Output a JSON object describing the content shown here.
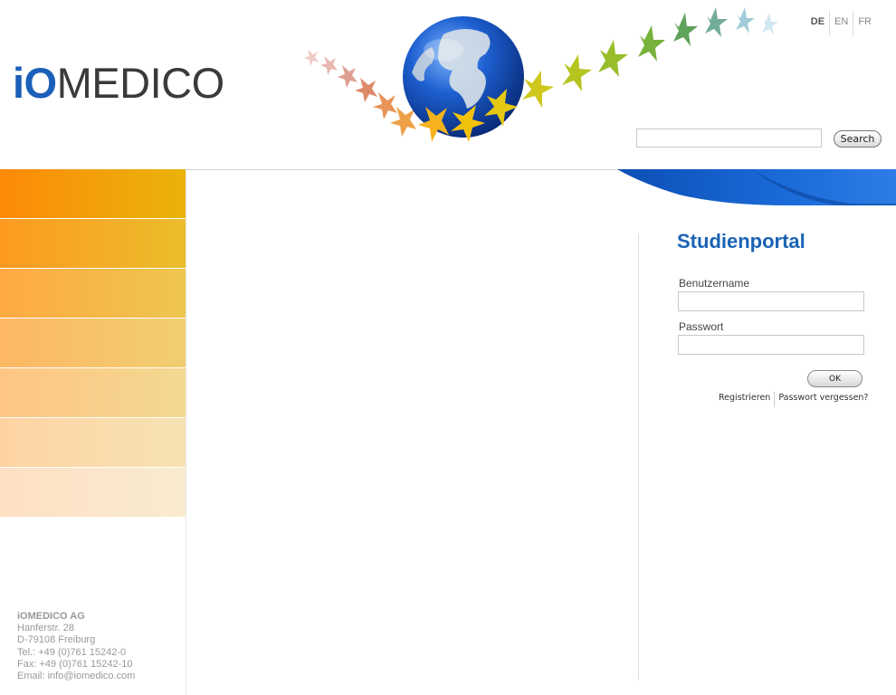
{
  "brand": {
    "logo_io": "iO",
    "logo_medico": "MEDICO"
  },
  "languages": [
    "DE",
    "EN",
    "FR"
  ],
  "search": {
    "value": "",
    "placeholder": "",
    "button_label": "Search"
  },
  "nav": {
    "items": [
      {
        "color_from": "#fd8a08",
        "color_to": "#e9b40a"
      },
      {
        "color_from": "#fd9a20",
        "color_to": "#ebbd2c"
      },
      {
        "color_from": "#fea942",
        "color_to": "#eec64f"
      },
      {
        "color_from": "#feb763",
        "color_to": "#f0cf70"
      },
      {
        "color_from": "#fec583",
        "color_to": "#f3d991"
      },
      {
        "color_from": "#fed3a4",
        "color_to": "#f6e2b3"
      },
      {
        "color_from": "#fee0c3",
        "color_to": "#f9ebcf"
      }
    ]
  },
  "login": {
    "title": "Studienportal",
    "username_label": "Benutzername",
    "username_value": "",
    "password_label": "Passwort",
    "password_value": "",
    "ok_label": "OK",
    "register_label": "Registrieren",
    "forgot_label": "Passwort vergessen?"
  },
  "address": {
    "company": "iOMEDICO AG",
    "street": "Hanferstr. 28",
    "city": "D-79108 Freiburg",
    "tel": "Tel.: +49 (0)761 15242-0",
    "fax": "Fax: +49 (0)761 15242-10",
    "email": "Email: info@iomedico.com"
  },
  "colors": {
    "brand_blue": "#1b5fb8",
    "title_blue": "#1b63b5",
    "swoosh_blue": "#1565c9"
  }
}
